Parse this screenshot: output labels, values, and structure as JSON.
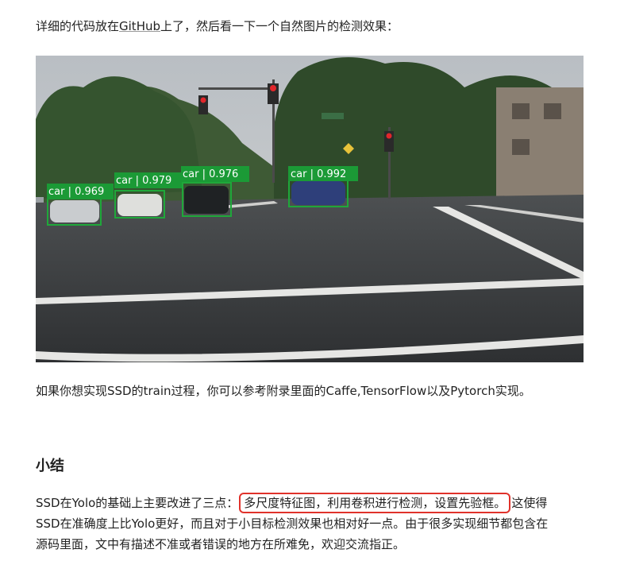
{
  "intro": {
    "before": "详细的代码放在",
    "link": "GitHub",
    "after": "上了，然后看一下一个自然图片的检测效果："
  },
  "figure": {
    "detections": [
      {
        "label": "car | 0.969"
      },
      {
        "label": "car | 0.979"
      },
      {
        "label": "car | 0.976"
      },
      {
        "label": "car | 0.992"
      }
    ]
  },
  "train_note": "如果你想实现SSD的train过程，你可以参考附录里面的Caffe,TensorFlow以及Pytorch实现。",
  "summary": {
    "heading": "小结",
    "line1_before": "SSD在Yolo的基础上主要改进了三点：",
    "line1_highlight": "多尺度特征图，利用卷积进行检测，设置先验框。",
    "line1_after": "这使得",
    "line2": "SSD在准确度上比Yolo更好，而且对于小目标检测效果也相对好一点。由于很多实现细节都包含在",
    "line3": "源码里面，文中有描述不准或者错误的地方在所难免，欢迎交流指正。"
  },
  "colors": {
    "highlight_border": "#e0322b",
    "detection_box": "#1fa83a",
    "detection_label_bg": "#1b9a36"
  }
}
